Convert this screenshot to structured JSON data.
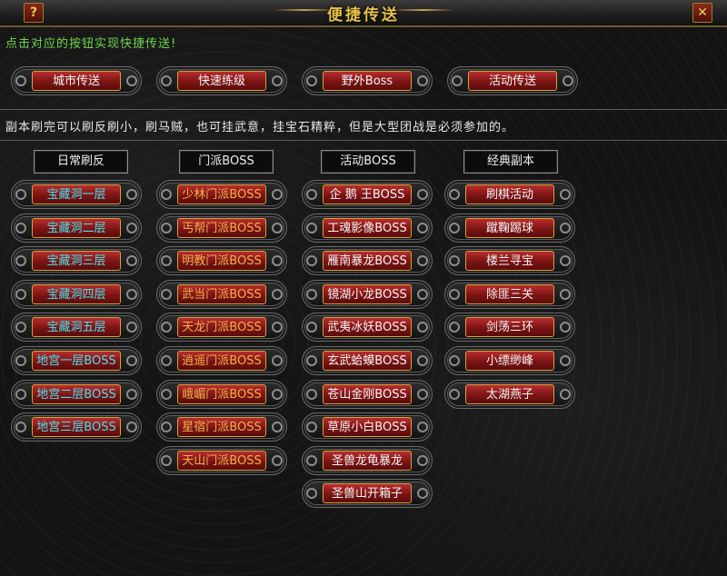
{
  "window": {
    "title": "便捷传送",
    "help_glyph": "?",
    "close_glyph": "✕"
  },
  "hint": "点击对应的按钮实现快捷传送!",
  "top_buttons": [
    "城市传送",
    "快速练级",
    "野外Boss",
    "活动传送"
  ],
  "note": "副本刷完可以刷反刷小，刷马贼，也可挂武意，挂宝石精粹，但是大型团战是必须参加的。",
  "categories": [
    {
      "label": "日常刷反",
      "items": [
        {
          "text": "宝藏洞一层",
          "color": "#43e3f0"
        },
        {
          "text": "宝藏洞二层",
          "color": "#43e3f0"
        },
        {
          "text": "宝藏洞三层",
          "color": "#43e3f0"
        },
        {
          "text": "宝藏洞四层",
          "color": "#43e3f0"
        },
        {
          "text": "宝藏洞五层",
          "color": "#43e3f0"
        },
        {
          "text": "地宫一层BOSS",
          "color": "#43e3f0"
        },
        {
          "text": "地宫二层BOSS",
          "color": "#43e3f0"
        },
        {
          "text": "地宫三层BOSS",
          "color": "#43e3f0"
        }
      ]
    },
    {
      "label": "门派BOSS",
      "items": [
        {
          "text": "少林门派BOSS",
          "color": "#f2b14a"
        },
        {
          "text": "丐帮门派BOSS",
          "color": "#f2b14a"
        },
        {
          "text": "明教门派BOSS",
          "color": "#f2b14a"
        },
        {
          "text": "武当门派BOSS",
          "color": "#f2b14a"
        },
        {
          "text": "天龙门派BOSS",
          "color": "#f2b14a"
        },
        {
          "text": "逍遥门派BOSS",
          "color": "#f2b14a"
        },
        {
          "text": "峨嵋门派BOSS",
          "color": "#f2b14a"
        },
        {
          "text": "星宿门派BOSS",
          "color": "#f2b14a"
        },
        {
          "text": "天山门派BOSS",
          "color": "#f2b14a"
        }
      ]
    },
    {
      "label": "活动BOSS",
      "items": [
        {
          "text": "企 鹅 王BOSS",
          "color": "#f4f4f4"
        },
        {
          "text": "工魂影像BOSS",
          "color": "#f4f4f4"
        },
        {
          "text": "雁南暴龙BOSS",
          "color": "#f4f4f4"
        },
        {
          "text": "镜湖小龙BOSS",
          "color": "#f4f4f4"
        },
        {
          "text": "武夷冰妖BOSS",
          "color": "#f4f4f4"
        },
        {
          "text": "玄武蛤蟆BOSS",
          "color": "#f4f4f4"
        },
        {
          "text": "苍山金刚BOSS",
          "color": "#f4f4f4"
        },
        {
          "text": "草原小白BOSS",
          "color": "#f4f4f4"
        },
        {
          "text": "圣兽龙龟暴龙",
          "color": "#f4f4f4"
        },
        {
          "text": "圣兽山开箱子",
          "color": "#f4f4f4"
        }
      ]
    },
    {
      "label": "经典副本",
      "items": [
        {
          "text": "刷棋活动",
          "color": "#f4f4f4"
        },
        {
          "text": "蹴鞠踢球",
          "color": "#f4f4f4"
        },
        {
          "text": "楼兰寻宝",
          "color": "#f4f4f4"
        },
        {
          "text": "除匪三关",
          "color": "#f4f4f4"
        },
        {
          "text": "剑荡三环",
          "color": "#f4f4f4"
        },
        {
          "text": "小缥缈峰",
          "color": "#f4f4f4"
        },
        {
          "text": "太湖燕子",
          "color": "#f4f4f4"
        }
      ]
    }
  ]
}
